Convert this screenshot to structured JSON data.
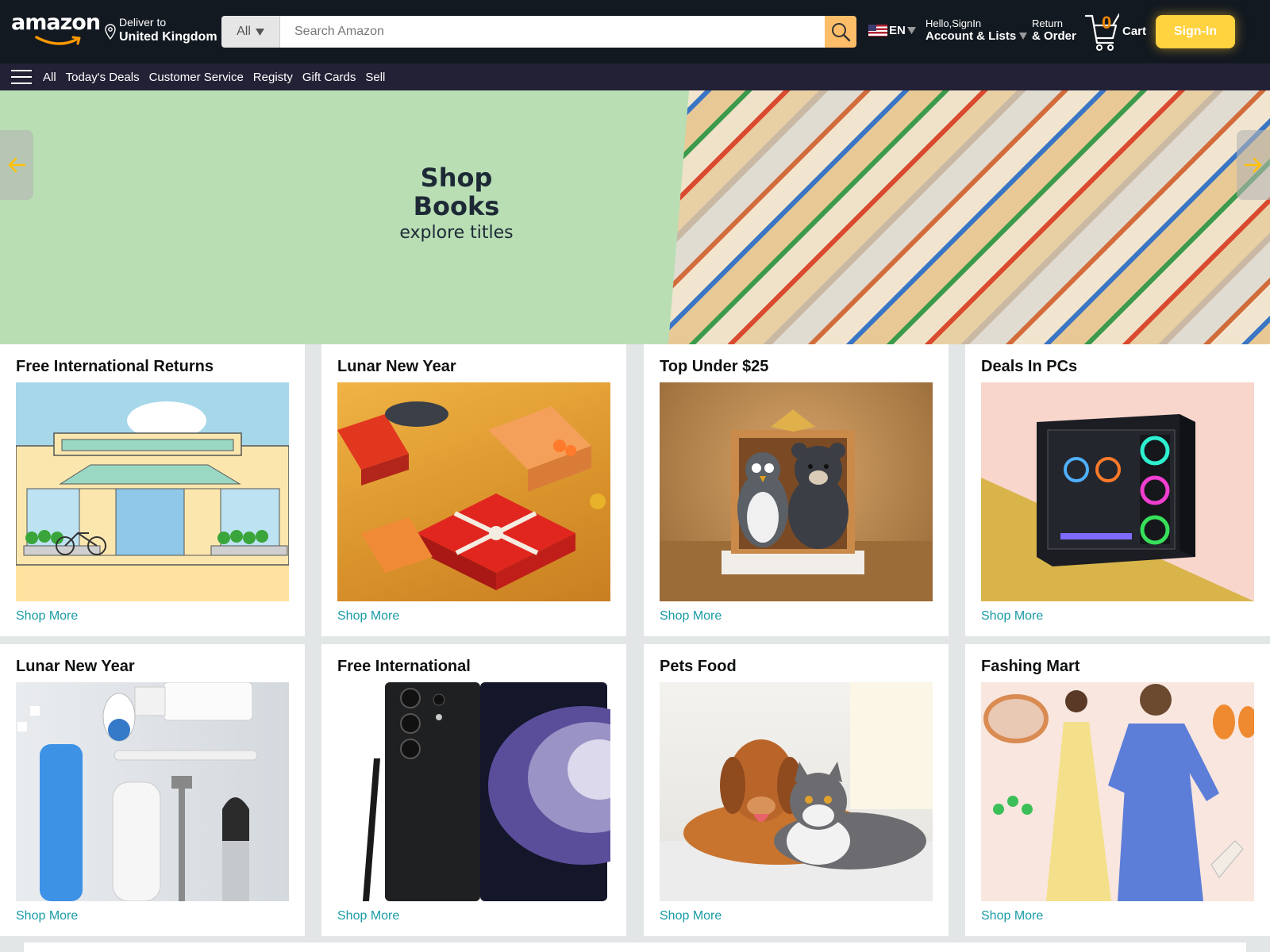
{
  "header": {
    "logo_text": "amazon",
    "deliver_label": "Deliver to",
    "deliver_location": "United Kingdom",
    "search_category": "All",
    "search_placeholder": "Search Amazon",
    "language": "EN",
    "account_greeting": "Hello,SignIn",
    "account_label": "Account & Lists",
    "returns_top": "Return",
    "returns_bottom": "& Order",
    "cart_count": "0",
    "cart_label": "Cart",
    "signin_label": "Sign-In"
  },
  "nav": {
    "items": [
      "All",
      "Today's Deals",
      "Customer Service",
      "Registy",
      "Gift Cards",
      "Sell"
    ]
  },
  "hero": {
    "title": "Shop Books",
    "subtitle": "explore titles"
  },
  "cards": [
    {
      "title": "Free International Returns",
      "link": "Shop More"
    },
    {
      "title": "Lunar New Year",
      "link": "Shop More"
    },
    {
      "title": "Top Under $25",
      "link": "Shop More"
    },
    {
      "title": "Deals In PCs",
      "link": "Shop More"
    },
    {
      "title": "Lunar New Year",
      "link": "Shop More"
    },
    {
      "title": "Free International",
      "link": "Shop More"
    },
    {
      "title": "Pets Food",
      "link": "Shop More"
    },
    {
      "title": "Fashing Mart",
      "link": "Shop More"
    }
  ],
  "colors": {
    "header_bg": "#131921",
    "nav_bg": "#232136",
    "hero_bg": "#b9deb4",
    "signin_bg": "#ffd23f",
    "link": "#1a9ba6",
    "cart_count": "#f08804"
  },
  "icons": [
    "map-pin-icon",
    "chevron-down-icon",
    "search-icon",
    "us-flag-icon",
    "cart-icon",
    "hamburger-icon",
    "arrow-left-icon",
    "arrow-right-icon"
  ]
}
